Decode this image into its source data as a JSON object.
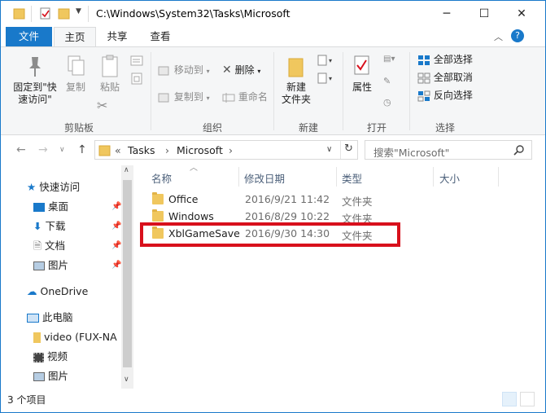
{
  "titlebar": {
    "path": "C:\\Windows\\System32\\Tasks\\Microsoft",
    "minimize": "─",
    "maximize": "☐",
    "close": "✕"
  },
  "tabs": [
    {
      "label": "文件"
    },
    {
      "label": "主页"
    },
    {
      "label": "共享"
    },
    {
      "label": "查看"
    }
  ],
  "ribbon": {
    "pin_label_1": "固定到\"快",
    "pin_label_2": "速访问\"",
    "copy": "复制",
    "paste": "粘贴",
    "clipboard_group": "剪贴板",
    "move_to": "移动到",
    "copy_to": "复制到",
    "delete": "删除",
    "rename": "重命名",
    "organize_group": "组织",
    "new_folder_1": "新建",
    "new_folder_2": "文件夹",
    "new_group": "新建",
    "properties": "属性",
    "open_group": "打开",
    "select_all": "全部选择",
    "select_none": "全部取消",
    "invert_selection": "反向选择",
    "select_group": "选择"
  },
  "address": {
    "crumbs": [
      "«",
      "Tasks",
      "›",
      "Microsoft",
      "›"
    ],
    "search_placeholder": "搜索\"Microsoft\""
  },
  "navpane": {
    "quick_access": "快速访问",
    "desktop": "桌面",
    "downloads": "下载",
    "documents": "文档",
    "pictures": "图片",
    "onedrive": "OneDrive",
    "this_pc": "此电脑",
    "video_drive": "video (FUX-NA",
    "videos": "视频",
    "pictures2": "图片"
  },
  "columns": {
    "name": "名称",
    "date": "修改日期",
    "type": "类型",
    "size": "大小"
  },
  "files": [
    {
      "name": "Office",
      "date": "2016/9/21 11:42",
      "type": "文件夹"
    },
    {
      "name": "Windows",
      "date": "2016/8/29 10:22",
      "type": "文件夹"
    },
    {
      "name": "XblGameSave",
      "date": "2016/9/30 14:30",
      "type": "文件夹"
    }
  ],
  "status": {
    "count": "3 个项目"
  },
  "colors": {
    "accent": "#1979ca",
    "highlight_box": "#d8101c",
    "folder": "#f0c75e"
  }
}
